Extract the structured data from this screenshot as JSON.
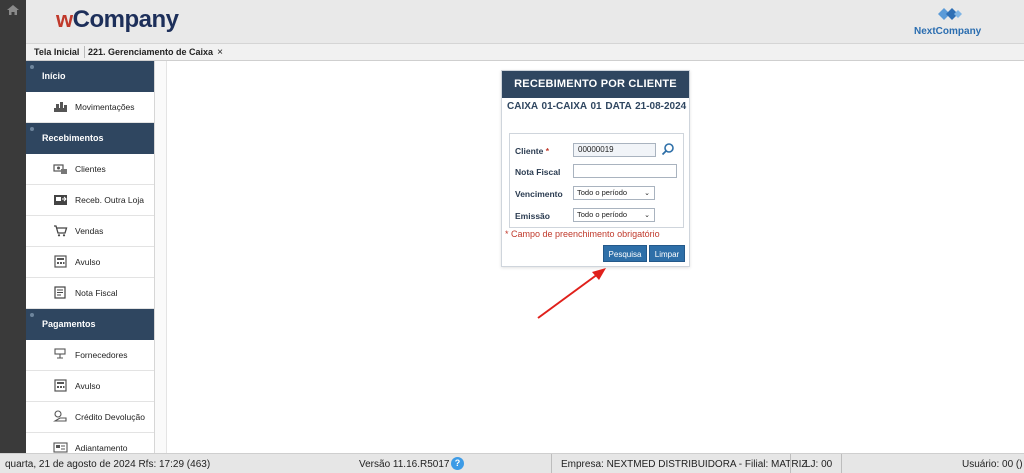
{
  "header": {
    "logo_prefix": "w",
    "logo_text": "Company",
    "brand_right": "NextCompany",
    "brand_color": "#1d2f5a",
    "accent": "#c0392b"
  },
  "tabs": {
    "home": "Tela Inicial",
    "active": "221. Gerenciamento de Caixa",
    "close_glyph": "×"
  },
  "sidebar": {
    "sections": [
      {
        "label": "Início",
        "items": [
          {
            "label": "Movimentações",
            "icon": "money-stack-icon"
          }
        ]
      },
      {
        "label": "Recebimentos",
        "items": [
          {
            "label": "Clientes",
            "icon": "clients-money-icon"
          },
          {
            "label": "Receb. Outra Loja",
            "icon": "store-transfer-icon"
          },
          {
            "label": "Vendas",
            "icon": "cart-icon"
          },
          {
            "label": "Avulso",
            "icon": "calculator-icon"
          },
          {
            "label": "Nota Fiscal",
            "icon": "invoice-icon"
          }
        ]
      },
      {
        "label": "Pagamentos",
        "items": [
          {
            "label": "Fornecedores",
            "icon": "supplier-icon"
          },
          {
            "label": "Avulso",
            "icon": "calculator-icon"
          },
          {
            "label": "Crédito Devolução",
            "icon": "refund-icon"
          },
          {
            "label": "Adiantamento",
            "icon": "advance-icon"
          }
        ]
      }
    ]
  },
  "panel": {
    "title": "RECEBIMENTO POR CLIENTE",
    "subtitle": "CAIXA  01-CAIXA 01  DATA  21-08-2024",
    "fields": {
      "cliente_label": "Cliente",
      "cliente_required": "*",
      "cliente_value": "00000019",
      "nota_fiscal_label": "Nota Fiscal",
      "nota_fiscal_value": "",
      "vencimento_label": "Vencimento",
      "vencimento_value": "Todo o período",
      "emissao_label": "Emissão",
      "emissao_value": "Todo o período"
    },
    "required_note": "* Campo de preenchimento obrigatório",
    "buttons": {
      "search": "Pesquisa",
      "clear": "Limpar"
    }
  },
  "footer": {
    "datetime": "quarta, 21 de agosto de 2024  Rfs: 17:29 (463)",
    "version": "Versão 11.16.R5017",
    "help": "?",
    "company": "Empresa: NEXTMED DISTRIBUIDORA - Filial: MATRIZ",
    "store": "LJ: 00",
    "user": "Usuário: 00 ()"
  }
}
